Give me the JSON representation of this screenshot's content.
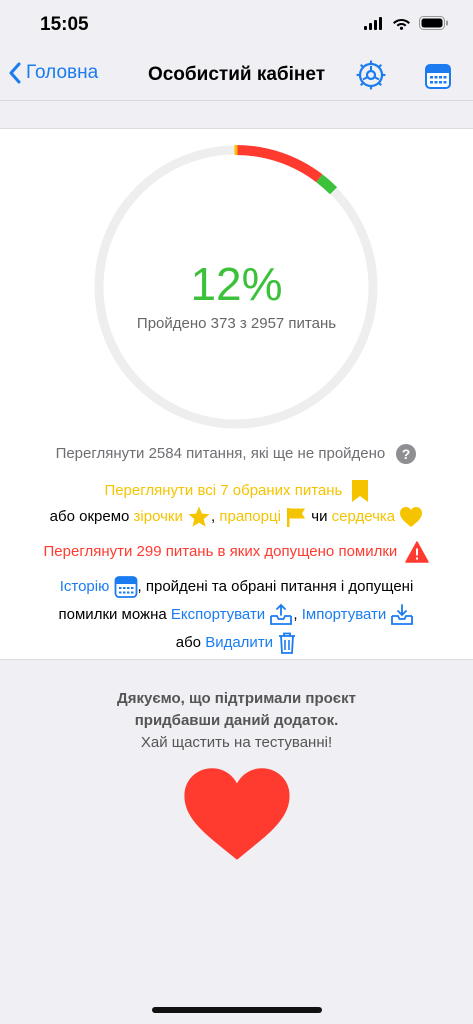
{
  "status_bar": {
    "time": "15:05"
  },
  "nav": {
    "back_label": "Головна",
    "title": "Особистий кабінет"
  },
  "progress": {
    "percent_text": "12%",
    "percent_value": 0.126,
    "caption": "Пройдено 373 з 2957 питань",
    "passed": 373,
    "total": 2957,
    "colors": {
      "correct": "#3cc13b",
      "wrong": "#ff3b30",
      "track": "#eeeeee",
      "marker": "#f5c400"
    }
  },
  "links": {
    "unpassed": "Переглянути 2584 питання, які ще не пройдено",
    "favorites": "Переглянути всі 7 обраних питань",
    "separately_prefix": "або окремо",
    "stars": "зірочки",
    "comma1": ",",
    "flags": "прапорці",
    "or_word": "чи",
    "hearts": "сердечка",
    "mistakes": "Переглянути 299 питань в яких допущено помилки",
    "history": "Історію",
    "history_text": ", пройдені та обрані питання і допущені",
    "errors_can": "помилки можна",
    "export": "Експортувати",
    "comma2": ",",
    "import": "Імпортувати",
    "or_prefix": "або",
    "delete": "Видалити"
  },
  "footer": {
    "thanks_line1": "Дякуємо, що підтримали проєкт",
    "thanks_line2": "придбавши даний додаток.",
    "wish": "Хай щастить на тестуванні!"
  }
}
